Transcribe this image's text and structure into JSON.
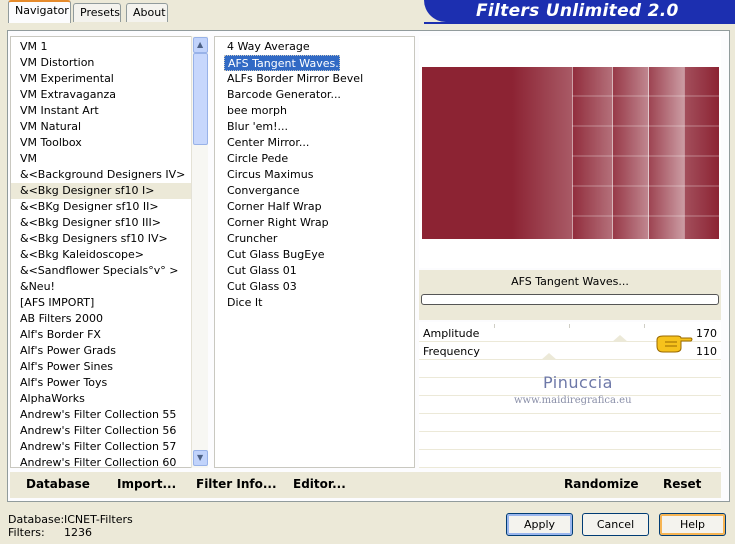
{
  "banner": {
    "title": "Filters Unlimited 2.0"
  },
  "tabs": [
    {
      "label": "Navigator"
    },
    {
      "label": "Presets"
    },
    {
      "label": "About"
    }
  ],
  "categories": [
    "VM 1",
    "VM Distortion",
    "VM Experimental",
    "VM Extravaganza",
    "VM Instant Art",
    "VM Natural",
    "VM Toolbox",
    "VM",
    "&<Background Designers IV>",
    "&<Bkg Designer sf10 I>",
    "&<BKg Designer sf10 II>",
    "&<Bkg Designer sf10 III>",
    "&<Bkg Designers sf10 IV>",
    "&<Bkg Kaleidoscope>",
    "&<Sandflower Specials°v° >",
    "&Neu!",
    "[AFS IMPORT]",
    "AB Filters 2000",
    "Alf's Border FX",
    "Alf's Power Grads",
    "Alf's Power Sines",
    "Alf's Power Toys",
    "AlphaWorks",
    "Andrew's Filter Collection 55",
    "Andrew's Filter Collection 56",
    "Andrew's Filter Collection 57",
    "Andrew's Filter Collection 60"
  ],
  "selected_category": "&<Bkg Designer sf10 I>",
  "filters": [
    "4 Way Average",
    "AFS Tangent Waves...",
    "ALFs Border Mirror Bevel",
    "Barcode Generator...",
    "bee morph",
    "Blur 'em!...",
    "Center Mirror...",
    "Circle Pede",
    "Circus Maximus",
    "Convergance",
    "Corner Half Wrap",
    "Corner Right Wrap",
    "Cruncher",
    "Cut Glass  BugEye",
    "Cut Glass 01",
    "Cut Glass 03",
    "Dice It"
  ],
  "selected_filter": "AFS Tangent Waves...",
  "preview": {
    "filter_name": "AFS Tangent Waves...",
    "color": "#8c2333"
  },
  "params": [
    {
      "label": "Amplitude",
      "value": "170"
    },
    {
      "label": "Frequency",
      "value": "110"
    }
  ],
  "watermark": {
    "name": "Pinuccia",
    "url": "www.maidiregrafica.eu"
  },
  "toolbar": {
    "database": "Database",
    "import": "Import...",
    "filter_info": "Filter Info...",
    "editor": "Editor...",
    "randomize": "Randomize",
    "reset": "Reset"
  },
  "footer": {
    "database_label": "Database:",
    "database_value": "ICNET-Filters",
    "filters_label": "Filters:",
    "filters_value": "1236",
    "apply": "Apply",
    "cancel": "Cancel",
    "help": "Help"
  }
}
